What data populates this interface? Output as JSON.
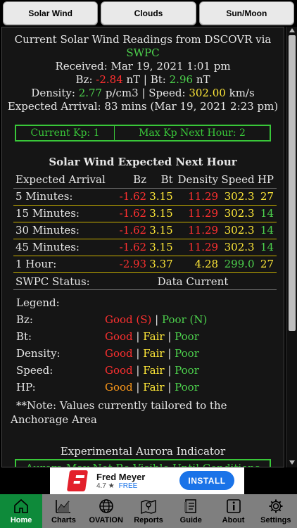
{
  "tabs": [
    "Solar Wind",
    "Clouds",
    "Sun/Moon"
  ],
  "readings": {
    "line1_prefix": "Current Solar Wind Readings from DSCOVR via ",
    "line1_link": "SWPC",
    "received": "Received: Mar 19, 2021 1:01 pm",
    "bz_label": "Bz: ",
    "bz_value": "-2.84",
    "bz_unit": " nT | Bt: ",
    "bt_value": "2.96",
    "bt_unit": " nT",
    "density_label": "Density: ",
    "density_value": "2.77",
    "density_unit": " p/cm3 | Speed: ",
    "speed_value": "302.00",
    "speed_unit": " km/s",
    "arrival": "Expected Arrival: 83 mins (Mar 19, 2021 2:23 pm)"
  },
  "kp": {
    "current": "Current Kp: 1",
    "max_next_hour": "Max Kp Next Hour: 2"
  },
  "table": {
    "title": "Solar Wind Expected Next Hour",
    "headers": [
      "Expected Arrival",
      "Bz",
      "Bt",
      "Density",
      "Speed",
      "HP"
    ],
    "rows": [
      {
        "label": "5 Minutes:",
        "bz": "-1.62",
        "bt": "3.15",
        "density": "11.29",
        "speed": "302.3",
        "hp": "27"
      },
      {
        "label": "15 Minutes:",
        "bz": "-1.62",
        "bt": "3.15",
        "density": "11.29",
        "speed": "302.3",
        "hp": "14"
      },
      {
        "label": "30 Minutes:",
        "bz": "-1.62",
        "bt": "3.15",
        "density": "11.29",
        "speed": "302.3",
        "hp": "14"
      },
      {
        "label": "45 Minutes:",
        "bz": "-1.62",
        "bt": "3.15",
        "density": "11.29",
        "speed": "302.3",
        "hp": "14"
      },
      {
        "label": "1 Hour:",
        "bz": "-2.93",
        "bt": "3.37",
        "density": "4.28",
        "speed": "299.0",
        "hp": "27"
      }
    ]
  },
  "status": {
    "label": "SWPC Status:",
    "value": "Data Current"
  },
  "legend": {
    "title": "Legend:",
    "bz": "Bz:",
    "bz_good": "Good (S)",
    "bz_poor": "Poor (N)",
    "bt": "Bt:",
    "density": "Density:",
    "speed": "Speed:",
    "hp": "HP:",
    "good": "Good",
    "fair": "Fair",
    "poor": "Poor",
    "sep": " | "
  },
  "note": "**Note: Values currently tailored to the Anchorage Area",
  "aurora": {
    "title": "Experimental Aurora Indicator",
    "message": "Aurora May Not Be Visible Until Conditions Improve"
  },
  "ad": {
    "name": "Fred Meyer",
    "rating": "4.7",
    "free": "FREE",
    "install": "INSTALL"
  },
  "nav": [
    "Home",
    "Charts",
    "OVATION",
    "Reports",
    "Guide",
    "About",
    "Settings"
  ],
  "colors": {
    "green": "#4dd24d",
    "red": "#ff3030",
    "yellow": "#ffe838",
    "orange": "#ff9a1a",
    "nav_active": "#0e8a3a",
    "nav_bg": "#7f7f7f"
  }
}
